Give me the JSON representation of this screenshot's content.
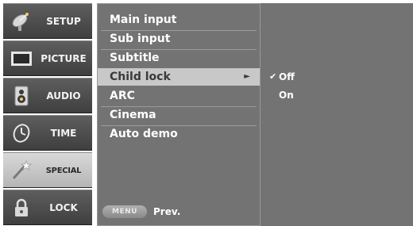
{
  "sidebar": {
    "tabs": [
      {
        "label": "SETUP",
        "icon": "satellite-dish-icon"
      },
      {
        "label": "PICTURE",
        "icon": "tv-screen-icon"
      },
      {
        "label": "AUDIO",
        "icon": "speaker-icon"
      },
      {
        "label": "TIME",
        "icon": "clock-icon"
      },
      {
        "label": "SPECIAL",
        "icon": "wand-icon",
        "active": true
      },
      {
        "label": "LOCK",
        "icon": "padlock-icon"
      }
    ]
  },
  "menu": {
    "items": [
      "Main input",
      "Sub input",
      "Subtitle",
      "Child lock",
      "ARC",
      "Cinema",
      "Auto demo"
    ],
    "selected": "Child lock",
    "submenu_arrow": "►",
    "footer": {
      "key_label": "MENU",
      "action_label": "Prev."
    }
  },
  "submenu": {
    "options": [
      {
        "label": "Off",
        "checked": true,
        "check_mark": "✔"
      },
      {
        "label": "On",
        "checked": false
      }
    ]
  },
  "colors": {
    "panel_bg": "#737373",
    "selected_bg": "#c8c8c8",
    "active_tab_bg": "#cfcfcf",
    "tab_bg": "#4f4f4f"
  }
}
